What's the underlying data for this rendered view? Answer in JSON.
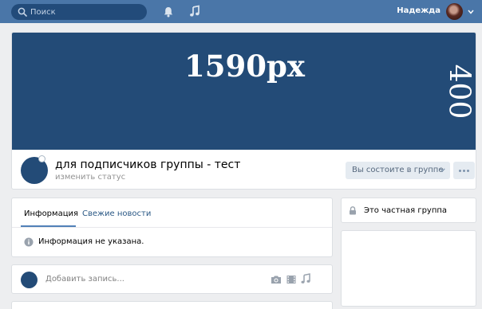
{
  "topbar": {
    "search_placeholder": "Поиск",
    "user_name": "Надежда",
    "icons": [
      "search-icon",
      "bell-icon",
      "music-note-icon",
      "chevron-down-icon"
    ]
  },
  "cover": {
    "width_text": "1590px",
    "height_text": "400"
  },
  "group": {
    "name": "для подписчиков группы - тест",
    "status_link": "изменить статус",
    "member_button": "Вы состоите в группе",
    "more_button": "..."
  },
  "info": {
    "tabs": [
      "Информация",
      "Свежие новости"
    ],
    "active_tab": "Информация",
    "empty_text": "Информация не указана."
  },
  "post": {
    "placeholder": "Добавить запись..."
  },
  "side": {
    "private_label": "Это частная группа"
  },
  "colors": {
    "topbar": "#4a76a8",
    "cover": "#234b77",
    "page_bg": "#edeef0",
    "link": "#2a5885",
    "accent": "#5181b8"
  }
}
